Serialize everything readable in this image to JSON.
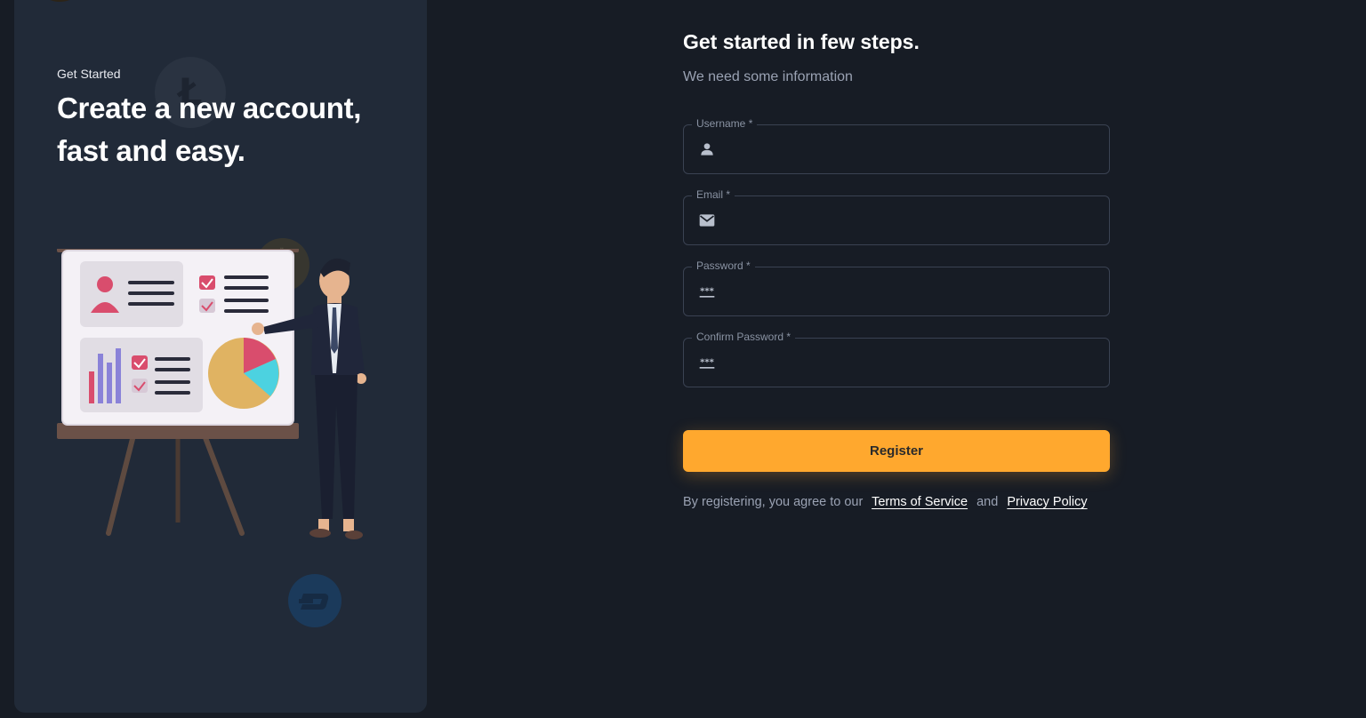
{
  "hero": {
    "eyebrow": "Get Started",
    "title": "Create a new account, fast and easy."
  },
  "form": {
    "title": "Get started in few steps.",
    "subtitle": "We need some information",
    "fields": [
      {
        "label": "Username *",
        "icon": "user-icon",
        "value": ""
      },
      {
        "label": "Email *",
        "icon": "mail-icon",
        "value": ""
      },
      {
        "label": "Password *",
        "icon": "password-icon",
        "value": ""
      },
      {
        "label": "Confirm Password *",
        "icon": "password-icon",
        "value": ""
      }
    ],
    "register_label": "Register",
    "terms_prefix": "By registering, you agree to our",
    "terms_link": "Terms of Service",
    "terms_and": "and",
    "privacy_link": "Privacy Policy"
  },
  "colors": {
    "background": "#171c25",
    "panel": "#212a38",
    "accent": "#ffa82e",
    "field_border": "#3a4252",
    "muted_text": "#9aa2b3"
  },
  "icons": [
    "litecoin-icon",
    "bitcoin-icon",
    "dash-icon",
    "user-icon",
    "mail-icon",
    "password-icon"
  ]
}
